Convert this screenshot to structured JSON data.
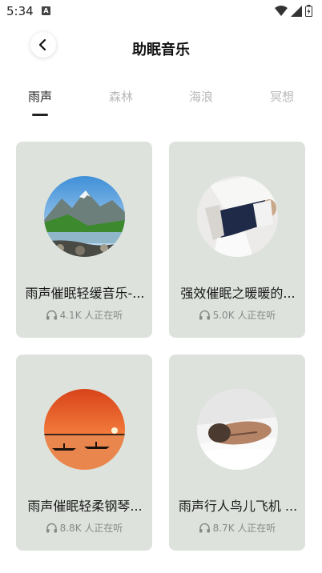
{
  "status": {
    "time": "5:34"
  },
  "header": {
    "title": "助眠音乐"
  },
  "tabs": [
    {
      "label": "雨声",
      "active": true
    },
    {
      "label": "森林",
      "active": false
    },
    {
      "label": "海浪",
      "active": false
    },
    {
      "label": "冥想",
      "active": false
    }
  ],
  "cards": [
    {
      "title": "雨声催眠轻缓音乐-...",
      "listeners": "4.1K 人正在听",
      "image": "mountain-lake"
    },
    {
      "title": "强效催眠之暖暖的...",
      "listeners": "5.0K 人正在听",
      "image": "sleeping-person-bed"
    },
    {
      "title": "雨声催眠轻柔钢琴...",
      "listeners": "8.8K 人正在听",
      "image": "sunset-boats"
    },
    {
      "title": "雨声行人鸟儿飞机 ...",
      "listeners": "8.7K 人正在听",
      "image": "man-sleeping-pillow"
    }
  ],
  "colors": {
    "card_bg": "#dde3dc",
    "accent": "#222222"
  }
}
